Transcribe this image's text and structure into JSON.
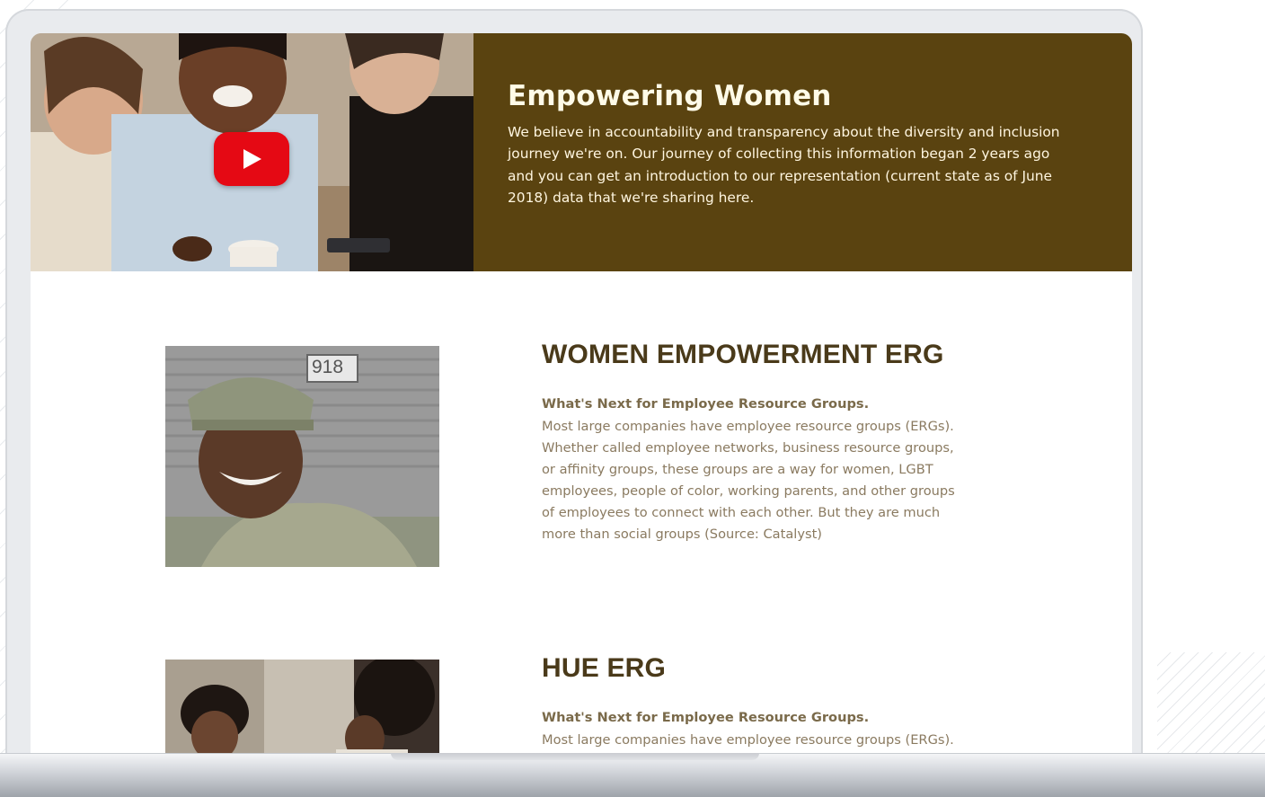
{
  "hero": {
    "title": "Empowering Women",
    "text": "We believe in accountability and transparency about the diversity and inclusion journey we're on. Our journey of collecting this information began 2 years ago and you can get an introduction to our representation (current state as of June 2018) data that we're sharing here.",
    "play_icon": "youtube-play-icon",
    "panel_color": "#5a4310"
  },
  "ergs": [
    {
      "title": "WOMEN EMPOWERMENT ERG",
      "subtitle": "What's Next for Employee Resource Groups.",
      "body": " Most large companies have employee resource groups (ERGs). Whether called employee networks, business resource groups, or affinity groups, these groups are a way for women, LGBT employees, people of color, working parents, and other groups of employees to connect with each other. But they are much more than social groups (Source: Catalyst)",
      "photo_badge": "918"
    },
    {
      "title": "HUE ERG",
      "subtitle": "What's Next for Employee Resource Groups.",
      "body": " Most large companies have employee resource groups (ERGs). Whether called employee networks, business"
    }
  ],
  "colors": {
    "title_brown": "#4a3a1a",
    "youtube_red": "#e50914"
  }
}
